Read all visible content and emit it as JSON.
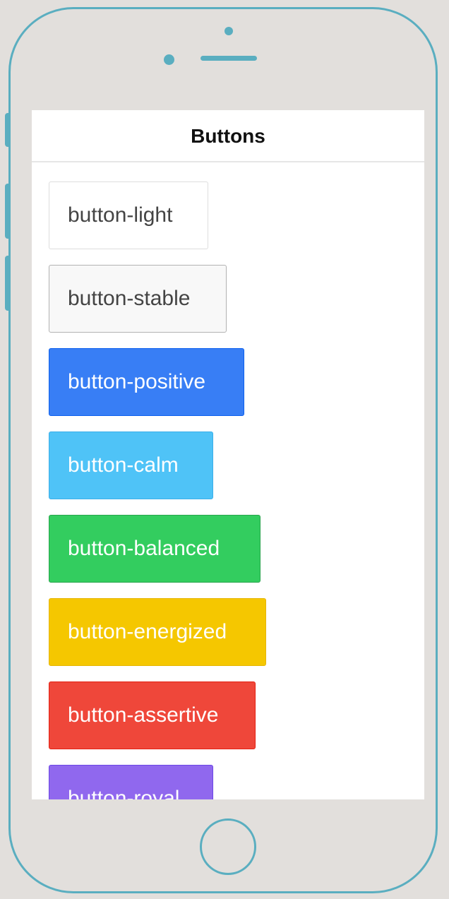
{
  "nav": {
    "title": "Buttons"
  },
  "buttons": [
    {
      "label": "button-light",
      "style": "light",
      "color": "#ffffff"
    },
    {
      "label": "button-stable",
      "style": "stable",
      "color": "#f8f8f8"
    },
    {
      "label": "button-positive",
      "style": "positive",
      "color": "#387ef5"
    },
    {
      "label": "button-calm",
      "style": "calm",
      "color": "#4fc3f7"
    },
    {
      "label": "button-balanced",
      "style": "balanced",
      "color": "#33cd5f"
    },
    {
      "label": "button-energized",
      "style": "energized",
      "color": "#f5c700"
    },
    {
      "label": "button-assertive",
      "style": "assertive",
      "color": "#ef473a"
    },
    {
      "label": "button-royal",
      "style": "royal",
      "color": "#9068ee"
    }
  ],
  "device": {
    "frame_color": "#5aaec0",
    "background_color": "#e2dfdc",
    "home_button_icon": "home-button-icon",
    "camera_icon": "front-camera-icon",
    "speaker_icon": "speaker-icon"
  }
}
